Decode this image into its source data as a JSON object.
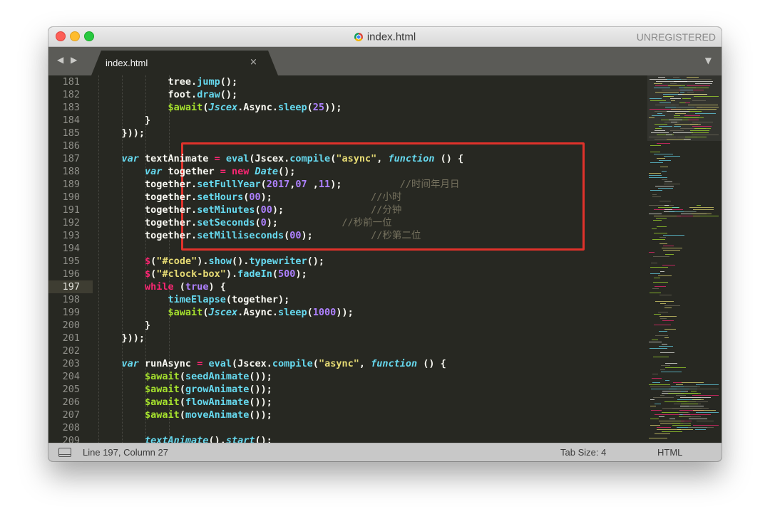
{
  "window": {
    "title": "index.html",
    "license": "UNREGISTERED"
  },
  "tabbar": {
    "nav_arrows": "◀ ▶",
    "active_tab": "index.html",
    "close_glyph": "×",
    "dropdown_glyph": "▼"
  },
  "editor": {
    "current_line": 197,
    "line_numbers": [
      "181",
      "182",
      "183",
      "184",
      "185",
      "186",
      "187",
      "188",
      "189",
      "190",
      "191",
      "192",
      "193",
      "194",
      "195",
      "196",
      "197",
      "198",
      "199",
      "200",
      "201",
      "202",
      "203",
      "204",
      "205",
      "206",
      "207",
      "208",
      "209"
    ],
    "colors": {
      "background": "#272822",
      "keyword": "#f92672",
      "string": "#e6db74",
      "number": "#ae81ff",
      "function": "#66d9ef",
      "comment": "#75715e",
      "highlight_border": "#e0322b"
    },
    "lines": [
      {
        "indent": 6,
        "tokens": [
          [
            "p",
            "tree."
          ],
          [
            "fn",
            "jump"
          ],
          [
            "p",
            "();"
          ]
        ]
      },
      {
        "indent": 6,
        "tokens": [
          [
            "p",
            "foot."
          ],
          [
            "fn",
            "draw"
          ],
          [
            "p",
            "();"
          ]
        ]
      },
      {
        "indent": 6,
        "tokens": [
          [
            "va",
            "$await"
          ],
          [
            "p",
            "("
          ],
          [
            "it",
            "Jscex"
          ],
          [
            "p",
            ".Async."
          ],
          [
            "fn",
            "sleep"
          ],
          [
            "p",
            "("
          ],
          [
            "nm",
            "25"
          ],
          [
            "p",
            "));"
          ]
        ]
      },
      {
        "indent": 4,
        "tokens": [
          [
            "p",
            "}"
          ]
        ]
      },
      {
        "indent": 2,
        "tokens": [
          [
            "p",
            "}));"
          ]
        ]
      },
      {
        "indent": 0,
        "tokens": []
      },
      {
        "indent": 2,
        "tokens": [
          [
            "it",
            "var"
          ],
          [
            "p",
            " textAnimate "
          ],
          [
            "kw",
            "="
          ],
          [
            "p",
            " "
          ],
          [
            "fn",
            "eval"
          ],
          [
            "p",
            "(Jscex."
          ],
          [
            "fn",
            "compile"
          ],
          [
            "p",
            "("
          ],
          [
            "st",
            "\"async\""
          ],
          [
            "p",
            ", "
          ],
          [
            "it",
            "function"
          ],
          [
            "p",
            " () {"
          ]
        ]
      },
      {
        "indent": 4,
        "tokens": [
          [
            "it",
            "var"
          ],
          [
            "p",
            " together "
          ],
          [
            "kw",
            "="
          ],
          [
            "p",
            " "
          ],
          [
            "kw",
            "new"
          ],
          [
            "p",
            " "
          ],
          [
            "it",
            "Date"
          ],
          [
            "p",
            "();"
          ]
        ]
      },
      {
        "indent": 4,
        "tokens": [
          [
            "p",
            "together."
          ],
          [
            "fn",
            "setFullYear"
          ],
          [
            "p",
            "("
          ],
          [
            "nm",
            "2017"
          ],
          [
            "p",
            ","
          ],
          [
            "nm",
            "07"
          ],
          [
            "p",
            " ,"
          ],
          [
            "nm",
            "11"
          ],
          [
            "p",
            ");"
          ],
          [
            "p",
            "          "
          ],
          [
            "cm",
            "//时间年月日"
          ]
        ]
      },
      {
        "indent": 4,
        "tokens": [
          [
            "p",
            "together."
          ],
          [
            "fn",
            "setHours"
          ],
          [
            "p",
            "("
          ],
          [
            "nm",
            "00"
          ],
          [
            "p",
            ");"
          ],
          [
            "p",
            "                 "
          ],
          [
            "cm",
            "//小时"
          ]
        ]
      },
      {
        "indent": 4,
        "tokens": [
          [
            "p",
            "together."
          ],
          [
            "fn",
            "setMinutes"
          ],
          [
            "p",
            "("
          ],
          [
            "nm",
            "00"
          ],
          [
            "p",
            ");"
          ],
          [
            "p",
            "               "
          ],
          [
            "cm",
            "//分钟"
          ]
        ]
      },
      {
        "indent": 4,
        "tokens": [
          [
            "p",
            "together."
          ],
          [
            "fn",
            "setSeconds"
          ],
          [
            "p",
            "("
          ],
          [
            "nm",
            "0"
          ],
          [
            "p",
            ");"
          ],
          [
            "p",
            "           "
          ],
          [
            "cm",
            "//秒前一位"
          ]
        ]
      },
      {
        "indent": 4,
        "tokens": [
          [
            "p",
            "together."
          ],
          [
            "fn",
            "setMilliseconds"
          ],
          [
            "p",
            "("
          ],
          [
            "nm",
            "00"
          ],
          [
            "p",
            ");"
          ],
          [
            "p",
            "          "
          ],
          [
            "cm",
            "//秒第二位"
          ]
        ]
      },
      {
        "indent": 0,
        "tokens": []
      },
      {
        "indent": 4,
        "tokens": [
          [
            "kw",
            "$"
          ],
          [
            "p",
            "("
          ],
          [
            "st",
            "\"#code\""
          ],
          [
            "p",
            ")."
          ],
          [
            "fn",
            "show"
          ],
          [
            "p",
            "()."
          ],
          [
            "fn",
            "typewriter"
          ],
          [
            "p",
            "();"
          ]
        ]
      },
      {
        "indent": 4,
        "tokens": [
          [
            "kw",
            "$"
          ],
          [
            "p",
            "("
          ],
          [
            "st",
            "\"#clock-box\""
          ],
          [
            "p",
            ")."
          ],
          [
            "fn",
            "fadeIn"
          ],
          [
            "p",
            "("
          ],
          [
            "nm",
            "500"
          ],
          [
            "p",
            ");"
          ]
        ]
      },
      {
        "indent": 4,
        "tokens": [
          [
            "kw",
            "while"
          ],
          [
            "p",
            " ("
          ],
          [
            "nm",
            "true"
          ],
          [
            "p",
            ") {"
          ]
        ]
      },
      {
        "indent": 6,
        "tokens": [
          [
            "fn",
            "timeElapse"
          ],
          [
            "p",
            "(together);"
          ]
        ]
      },
      {
        "indent": 6,
        "tokens": [
          [
            "va",
            "$await"
          ],
          [
            "p",
            "("
          ],
          [
            "it",
            "Jscex"
          ],
          [
            "p",
            ".Async."
          ],
          [
            "fn",
            "sleep"
          ],
          [
            "p",
            "("
          ],
          [
            "nm",
            "1000"
          ],
          [
            "p",
            "));"
          ]
        ]
      },
      {
        "indent": 4,
        "tokens": [
          [
            "p",
            "}"
          ]
        ]
      },
      {
        "indent": 2,
        "tokens": [
          [
            "p",
            "}));"
          ]
        ]
      },
      {
        "indent": 0,
        "tokens": []
      },
      {
        "indent": 2,
        "tokens": [
          [
            "it",
            "var"
          ],
          [
            "p",
            " runAsync "
          ],
          [
            "kw",
            "="
          ],
          [
            "p",
            " "
          ],
          [
            "fn",
            "eval"
          ],
          [
            "p",
            "(Jscex."
          ],
          [
            "fn",
            "compile"
          ],
          [
            "p",
            "("
          ],
          [
            "st",
            "\"async\""
          ],
          [
            "p",
            ", "
          ],
          [
            "it",
            "function"
          ],
          [
            "p",
            " () {"
          ]
        ]
      },
      {
        "indent": 4,
        "tokens": [
          [
            "va",
            "$await"
          ],
          [
            "p",
            "("
          ],
          [
            "fn",
            "seedAnimate"
          ],
          [
            "p",
            "());"
          ]
        ]
      },
      {
        "indent": 4,
        "tokens": [
          [
            "va",
            "$await"
          ],
          [
            "p",
            "("
          ],
          [
            "fn",
            "growAnimate"
          ],
          [
            "p",
            "());"
          ]
        ]
      },
      {
        "indent": 4,
        "tokens": [
          [
            "va",
            "$await"
          ],
          [
            "p",
            "("
          ],
          [
            "fn",
            "flowAnimate"
          ],
          [
            "p",
            "());"
          ]
        ]
      },
      {
        "indent": 4,
        "tokens": [
          [
            "va",
            "$await"
          ],
          [
            "p",
            "("
          ],
          [
            "fn",
            "moveAnimate"
          ],
          [
            "p",
            "());"
          ]
        ]
      },
      {
        "indent": 0,
        "tokens": []
      },
      {
        "indent": 4,
        "tokens": [
          [
            "it",
            "textAnimate"
          ],
          [
            "p",
            "()."
          ],
          [
            "it",
            "start"
          ],
          [
            "p",
            "();"
          ]
        ]
      }
    ]
  },
  "statusbar": {
    "position": "Line 197, Column 27",
    "tab_size": "Tab Size: 4",
    "syntax": "HTML"
  }
}
